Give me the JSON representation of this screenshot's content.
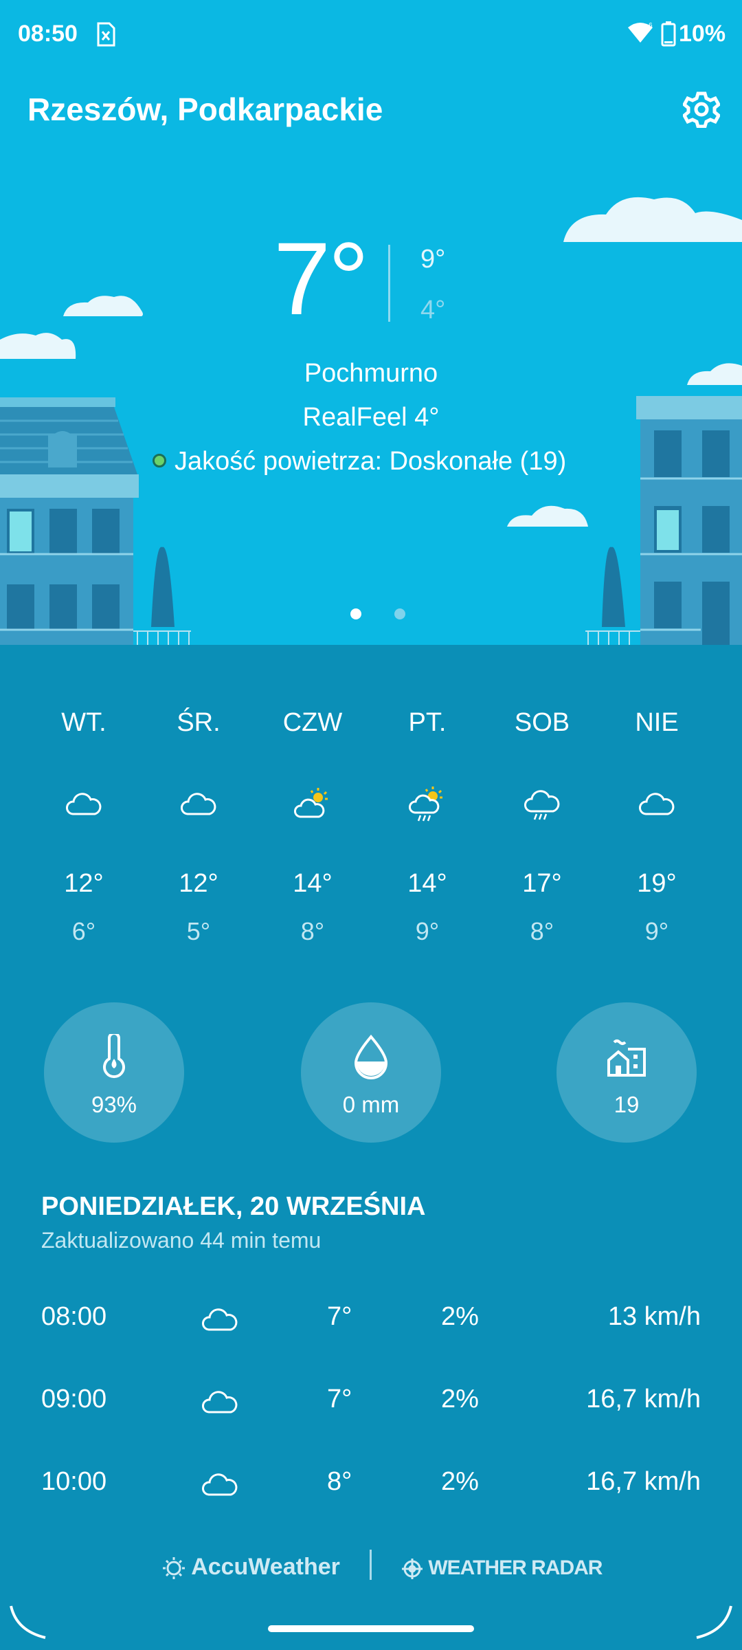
{
  "status_bar": {
    "time": "08:50",
    "battery": "10%"
  },
  "header": {
    "location": "Rzeszów, Podkarpackie"
  },
  "current": {
    "temp": "7°",
    "high": "9°",
    "low": "4°",
    "condition": "Pochmurno",
    "realfeel": "RealFeel 4°",
    "air_quality": "Jakość powietrza: Doskonałe (19)",
    "air_quality_color": "#6bd26a"
  },
  "forecast": [
    {
      "day": "WT.",
      "icon": "cloud-icon",
      "high": "12°",
      "low": "6°"
    },
    {
      "day": "ŚR.",
      "icon": "cloud-icon",
      "high": "12°",
      "low": "5°"
    },
    {
      "day": "CZW",
      "icon": "partly-sunny-icon",
      "high": "14°",
      "low": "8°"
    },
    {
      "day": "PT.",
      "icon": "sun-rain-icon",
      "high": "14°",
      "low": "9°"
    },
    {
      "day": "SOB",
      "icon": "rain-icon",
      "high": "17°",
      "low": "8°"
    },
    {
      "day": "NIE",
      "icon": "cloud-icon",
      "high": "19°",
      "low": "9°"
    }
  ],
  "stats": {
    "humidity": "93%",
    "precipitation": "0 mm",
    "aqi": "19"
  },
  "today": {
    "date": "PONIEDZIAŁEK, 20 WRZEŚNIA",
    "updated": "Zaktualizowano 44 min temu"
  },
  "hourly": [
    {
      "time": "08:00",
      "icon": "cloud-icon",
      "temp": "7°",
      "precip": "2%",
      "wind": "13 km/h"
    },
    {
      "time": "09:00",
      "icon": "cloud-icon",
      "temp": "7°",
      "precip": "2%",
      "wind": "16,7 km/h"
    },
    {
      "time": "10:00",
      "icon": "cloud-icon",
      "temp": "8°",
      "precip": "2%",
      "wind": "16,7 km/h"
    }
  ],
  "footer": {
    "brand1": "AccuWeather",
    "brand2": "WEATHER RADAR"
  },
  "colors": {
    "sky": "#0bb8e3",
    "body": "#0b8fb7",
    "sun": "#f5c518"
  }
}
